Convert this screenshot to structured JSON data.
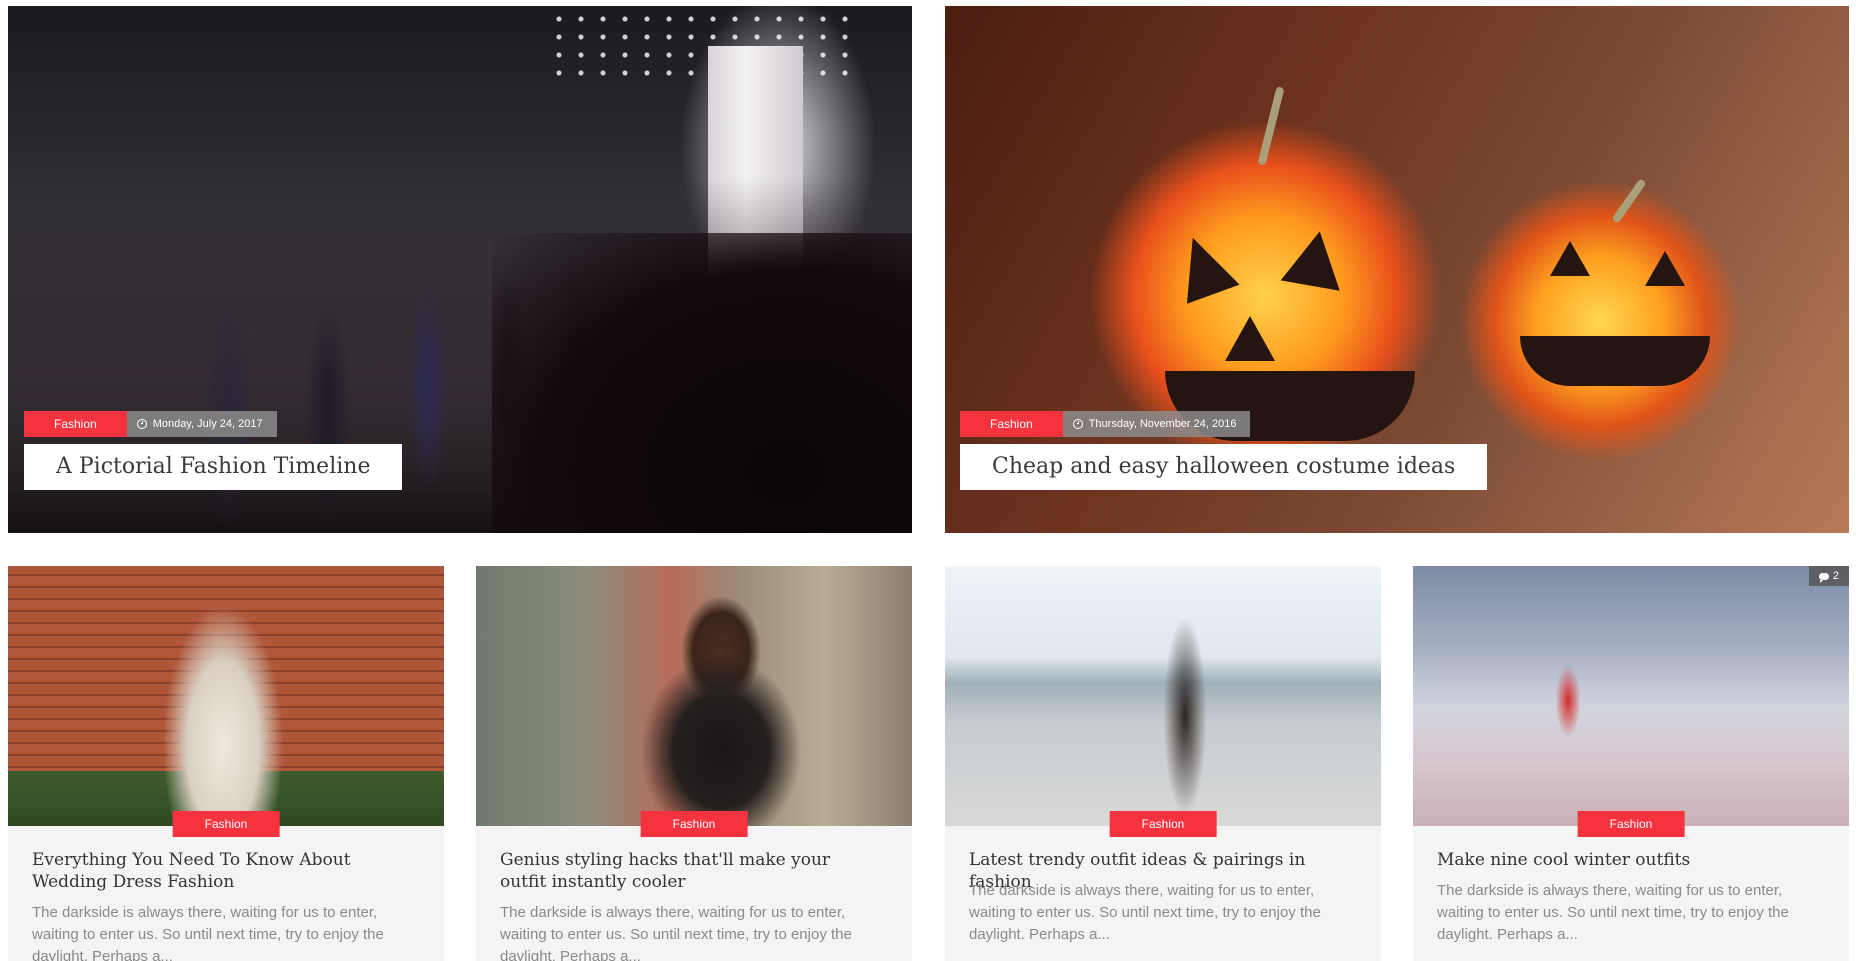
{
  "featured": [
    {
      "category": "Fashion",
      "date": "Monday, July 24, 2017",
      "title": "A Pictorial Fashion Timeline"
    },
    {
      "category": "Fashion",
      "date": "Thursday, November 24, 2016",
      "title": "Cheap and easy halloween costume ideas"
    }
  ],
  "cards": [
    {
      "category": "Fashion",
      "title": "Everything You Need To Know About Wedding Dress Fashion",
      "excerpt": "The darkside is always there, waiting for us to enter, waiting to enter us. So until next time, try to enjoy the daylight. Perhaps a..."
    },
    {
      "category": "Fashion",
      "title": "Genius styling hacks that'll make your outfit instantly cooler",
      "excerpt": "The darkside is always there, waiting for us to enter, waiting to enter us. So until next time, try to enjoy the daylight. Perhaps a..."
    },
    {
      "category": "Fashion",
      "title": "Latest trendy outfit ideas & pairings in fashion",
      "excerpt": "The darkside is always there, waiting for us to enter, waiting to enter us. So until next time, try to enjoy the daylight. Perhaps a..."
    },
    {
      "category": "Fashion",
      "title": "Make nine cool winter outfits",
      "comment_count": "2",
      "excerpt": "The darkside is always there, waiting for us to enter, waiting to enter us. So until next time, try to enjoy the daylight. Perhaps a..."
    }
  ],
  "colors": {
    "accent": "#f5333f",
    "card_bg": "#f4f4f4",
    "excerpt": "#8a8a8a",
    "title": "#333333"
  },
  "icons": {
    "date": "clock-icon",
    "comments": "comment-icon"
  }
}
